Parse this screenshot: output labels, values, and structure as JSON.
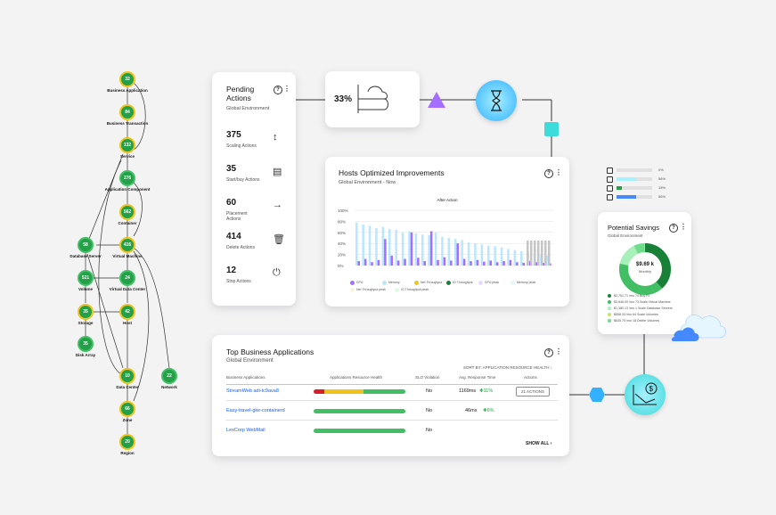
{
  "topology": {
    "nodes": [
      {
        "value": "32",
        "label": "Business Application"
      },
      {
        "value": "84",
        "label": "Business Transaction"
      },
      {
        "value": "132",
        "label": "Service"
      },
      {
        "value": "276",
        "label": "Application Component"
      },
      {
        "value": "562",
        "label": "Container"
      },
      {
        "value": "58",
        "label": "Database Server"
      },
      {
        "value": "416",
        "label": "Virtual Machine"
      },
      {
        "value": "521",
        "label": "Volume"
      },
      {
        "value": "24",
        "label": "Virtual Data Center"
      },
      {
        "value": "35",
        "label": "Storage"
      },
      {
        "value": "42",
        "label": "Host"
      },
      {
        "value": "35",
        "label": "Disk Array"
      },
      {
        "value": "10",
        "label": "Data Center"
      },
      {
        "value": "22",
        "label": "Network"
      },
      {
        "value": "66",
        "label": "Zone"
      },
      {
        "value": "20",
        "label": "Region"
      }
    ]
  },
  "pending": {
    "title": "Pending Actions",
    "subtitle": "Global Environment",
    "items": [
      {
        "count": "375",
        "label": "Scaling Actions",
        "icon": "↕"
      },
      {
        "count": "35",
        "label": "Start/buy Actions",
        "icon": "▤"
      },
      {
        "count": "60",
        "label": "Placement Actions",
        "icon": "→"
      },
      {
        "count": "414",
        "label": "Delete Actions",
        "icon": "🗑"
      },
      {
        "count": "12",
        "label": "Stop Actions",
        "icon": "⏻"
      }
    ]
  },
  "flow": {
    "percent": "33%"
  },
  "hosts": {
    "title": "Hosts Optimized Improvements",
    "subtitle": "Global Environment - Now",
    "chart_title": "After Action",
    "legend": [
      {
        "name": "CPU",
        "color": "#a56eff"
      },
      {
        "name": "Memory",
        "color": "#bae6ff"
      },
      {
        "name": "Net Throughput",
        "color": "#f1c21b"
      },
      {
        "name": "IO Throughput",
        "color": "#198038"
      },
      {
        "name": "CPU peak",
        "color": "#e8daff"
      },
      {
        "name": "Memory peak",
        "color": "#e5f6ff"
      },
      {
        "name": "Net Throughput peak",
        "color": "#fcf4d6"
      },
      {
        "name": "IO Throughput peak",
        "color": "#defbe6"
      }
    ]
  },
  "chart_data": {
    "type": "bar",
    "title": "After Action",
    "ylim": [
      0,
      100
    ],
    "yticks": [
      "100%",
      "80%",
      "60%",
      "40%",
      "20%",
      "0%"
    ],
    "series": [
      {
        "name": "Memory",
        "values": [
          78,
          74,
          72,
          68,
          70,
          66,
          65,
          60,
          62,
          58,
          56,
          55,
          60,
          52,
          50,
          48,
          46,
          42,
          40,
          38,
          36,
          35,
          33,
          30,
          28,
          26,
          25,
          22,
          20,
          18
        ]
      },
      {
        "name": "CPU",
        "values": [
          8,
          12,
          6,
          10,
          48,
          18,
          9,
          12,
          60,
          14,
          8,
          62,
          10,
          15,
          9,
          40,
          12,
          8,
          10,
          7,
          9,
          6,
          8,
          10,
          6,
          5,
          8,
          6,
          5,
          4
        ]
      }
    ]
  },
  "apps": {
    "title": "Top Business Applications",
    "subtitle": "Global Environment",
    "sort_label": "SORT BY: APPLICATION RESOURCE HEALTH",
    "headers": [
      "Business Applications",
      "Applications Resource Health",
      "SLO Violation",
      "Avg. Response Time",
      "Actions"
    ],
    "rows": [
      {
        "name": "StreamWeb adi-tc9ava8",
        "slo": "No",
        "rt": "1169ms",
        "delta": "11%",
        "action": "21 ACTIONS",
        "health": [
          0.12,
          0.42,
          0.46
        ]
      },
      {
        "name": "Easy-travel-gke-containerd",
        "slo": "No",
        "rt": "46ms",
        "delta": "6%",
        "action": "",
        "health": [
          0,
          0,
          1
        ]
      },
      {
        "name": "LexCorp WebMail",
        "slo": "No",
        "rt": "",
        "delta": "",
        "action": "",
        "health": [
          0,
          0,
          1
        ]
      }
    ],
    "show_all": "SHOW ALL"
  },
  "savings": {
    "title": "Potential Savings",
    "subtitle": "Global Environment",
    "center_value": "$9.69 k",
    "center_label": "Monthly",
    "items": [
      {
        "text": "$3,751.71 /mo  74 Buy RI",
        "color": "#198038"
      },
      {
        "text": "$3,846.00 /mo  73 Scale Virtual Machine",
        "color": "#42be65"
      },
      {
        "text": "$1,380.13 /mo  1 Scale Database Servers",
        "color": "#a7f0ba"
      },
      {
        "text": "$558.33 /mo  64 Scale Volumes",
        "color": "#c8e36b"
      },
      {
        "text": "$635.75 /mo  18 Delete Volumes",
        "color": "#6fdc8c"
      }
    ]
  },
  "mini_bars": [
    {
      "pct": "0%",
      "fill": 0,
      "color": "#6fdc8c"
    },
    {
      "pct": "56%",
      "fill": 0.56,
      "color": "#a6f0ff"
    },
    {
      "pct": "15%",
      "fill": 0.15,
      "color": "#24a148"
    },
    {
      "pct": "56%",
      "fill": 0.56,
      "color": "#4589ff"
    }
  ]
}
